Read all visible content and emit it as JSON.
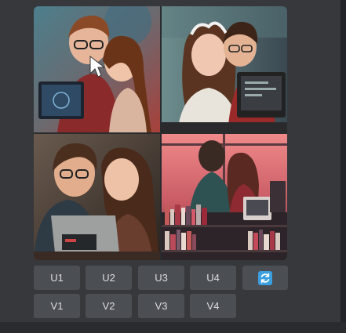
{
  "image_grid": {
    "tiles": [
      {
        "index": 1,
        "subject": "couple-laptop-smiling"
      },
      {
        "index": 2,
        "subject": "couple-monitor-embrace"
      },
      {
        "index": 3,
        "subject": "couple-laptop-closeup"
      },
      {
        "index": 4,
        "subject": "couple-library-sunset"
      }
    ]
  },
  "buttons": {
    "upscale": [
      "U1",
      "U2",
      "U3",
      "U4"
    ],
    "variation": [
      "V1",
      "V2",
      "V3",
      "V4"
    ],
    "reroll_icon": "refresh-icon"
  },
  "colors": {
    "button_bg": "#4b4e53",
    "button_text": "#dcdde0",
    "reroll_icon": "#3aa0e0",
    "background": "#36383c"
  }
}
